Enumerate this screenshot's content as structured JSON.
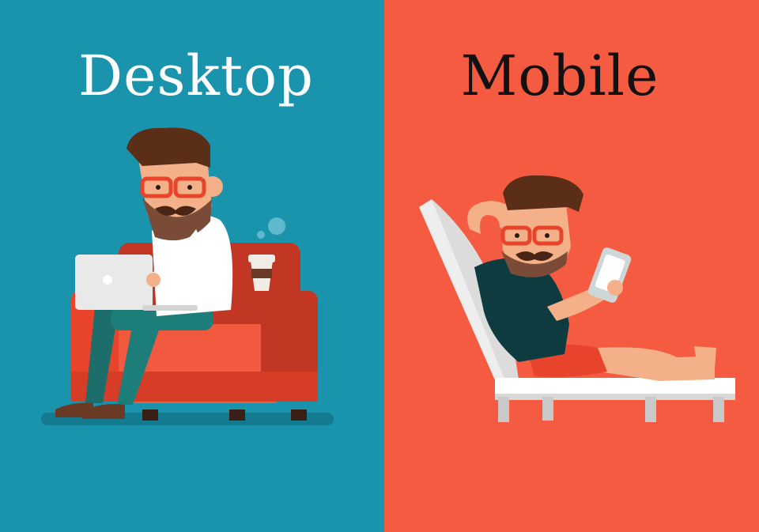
{
  "panels": {
    "left": {
      "title": "Desktop",
      "background": "#1a93ad",
      "title_color": "#ffffff"
    },
    "right": {
      "title": "Mobile",
      "background": "#f45b40",
      "title_color": "#111111"
    }
  },
  "colors": {
    "hair": "#5a2e17",
    "skin": "#f4b088",
    "glasses": "#e8442b",
    "armchair": "#e8442b",
    "armchair_dark": "#c23624",
    "shirt_white": "#ffffff",
    "shirt_dark": "#0d3b40",
    "pants_teal": "#1d7d78",
    "shorts": "#e8442b",
    "lounger": "#f2f2f2",
    "laptop": "#e9e9e9"
  }
}
